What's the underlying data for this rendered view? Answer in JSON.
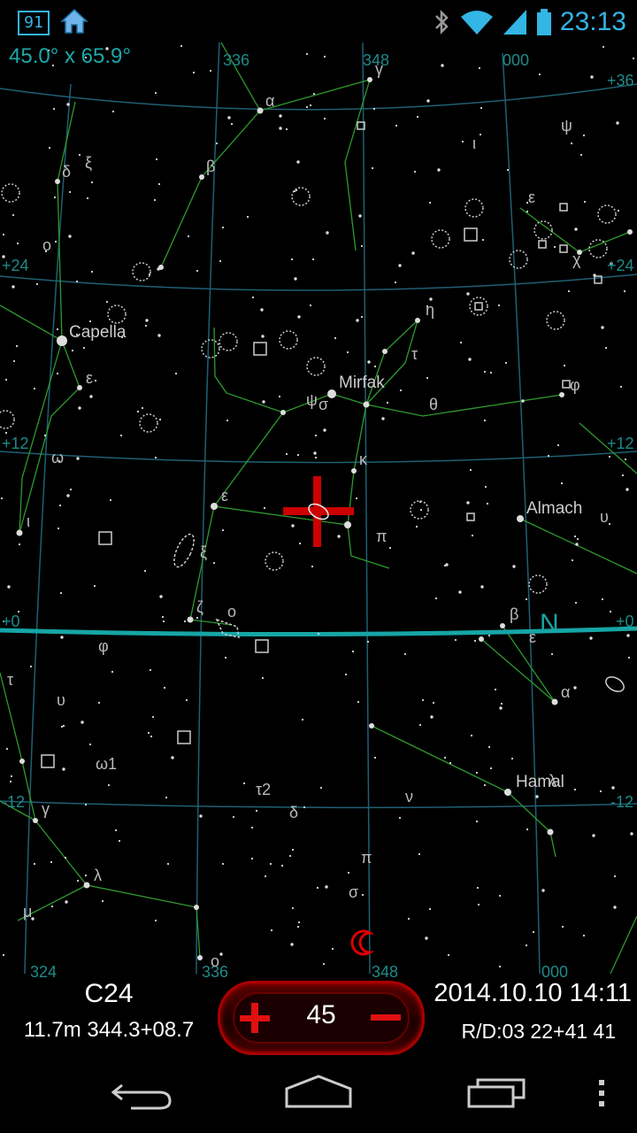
{
  "status_bar": {
    "notification_badge": "91",
    "home_icon": "home-icon",
    "bluetooth_icon": "bluetooth-icon",
    "wifi_icon": "wifi-icon",
    "signal_icon": "signal-icon",
    "battery_icon": "battery-icon",
    "time": "23:13",
    "accent_color": "#33b5e5"
  },
  "sky_map": {
    "fov_label": "45.0° x 65.9°",
    "ra_labels": [
      "336",
      "348",
      "000",
      "324",
      "336",
      "348",
      "000"
    ],
    "dec_labels": [
      "+36",
      "+24",
      "+24",
      "+12",
      "+12",
      "+0",
      "+0",
      "-12",
      "-12"
    ],
    "horizon_label": "N",
    "star_names": [
      "Capella",
      "Mirfak",
      "Almach",
      "Hamal"
    ],
    "greek_labels": [
      "γ",
      "α",
      "β",
      "δ",
      "ξ",
      "ο",
      "ψ",
      "ι",
      "ε",
      "χ",
      "η",
      "τ",
      "ε",
      "ψ",
      "σ",
      "θ",
      "φ",
      "κ",
      "ω",
      "ε",
      "ι",
      "π",
      "υ",
      "ξ",
      "ζ",
      "ο",
      "β",
      "ε",
      "φ",
      "τ",
      "α",
      "υ",
      "ω1",
      "τ2",
      "δ",
      "ν",
      "γ",
      "λ",
      "π",
      "σ",
      "μ",
      "ο",
      "λ"
    ],
    "grid_color": "#1f5f73",
    "constellation_color": "#2e9a2e",
    "horizon_color": "#17a5a5",
    "crosshair_color": "#cc0000"
  },
  "object_panel": {
    "name": "C24",
    "info": "11.7m 344.3+08.7"
  },
  "zoom_control": {
    "value": "45",
    "plus_icon": "plus-icon",
    "minus_icon": "minus-icon"
  },
  "datetime_panel": {
    "datetime": "2014.10.10 14:11",
    "rd": "R/D:03 22+41 41"
  },
  "nav_bar": {
    "back_icon": "back-icon",
    "home_icon": "home-outline-icon",
    "recents_icon": "recents-icon",
    "menu_icon": "overflow-menu-icon"
  }
}
